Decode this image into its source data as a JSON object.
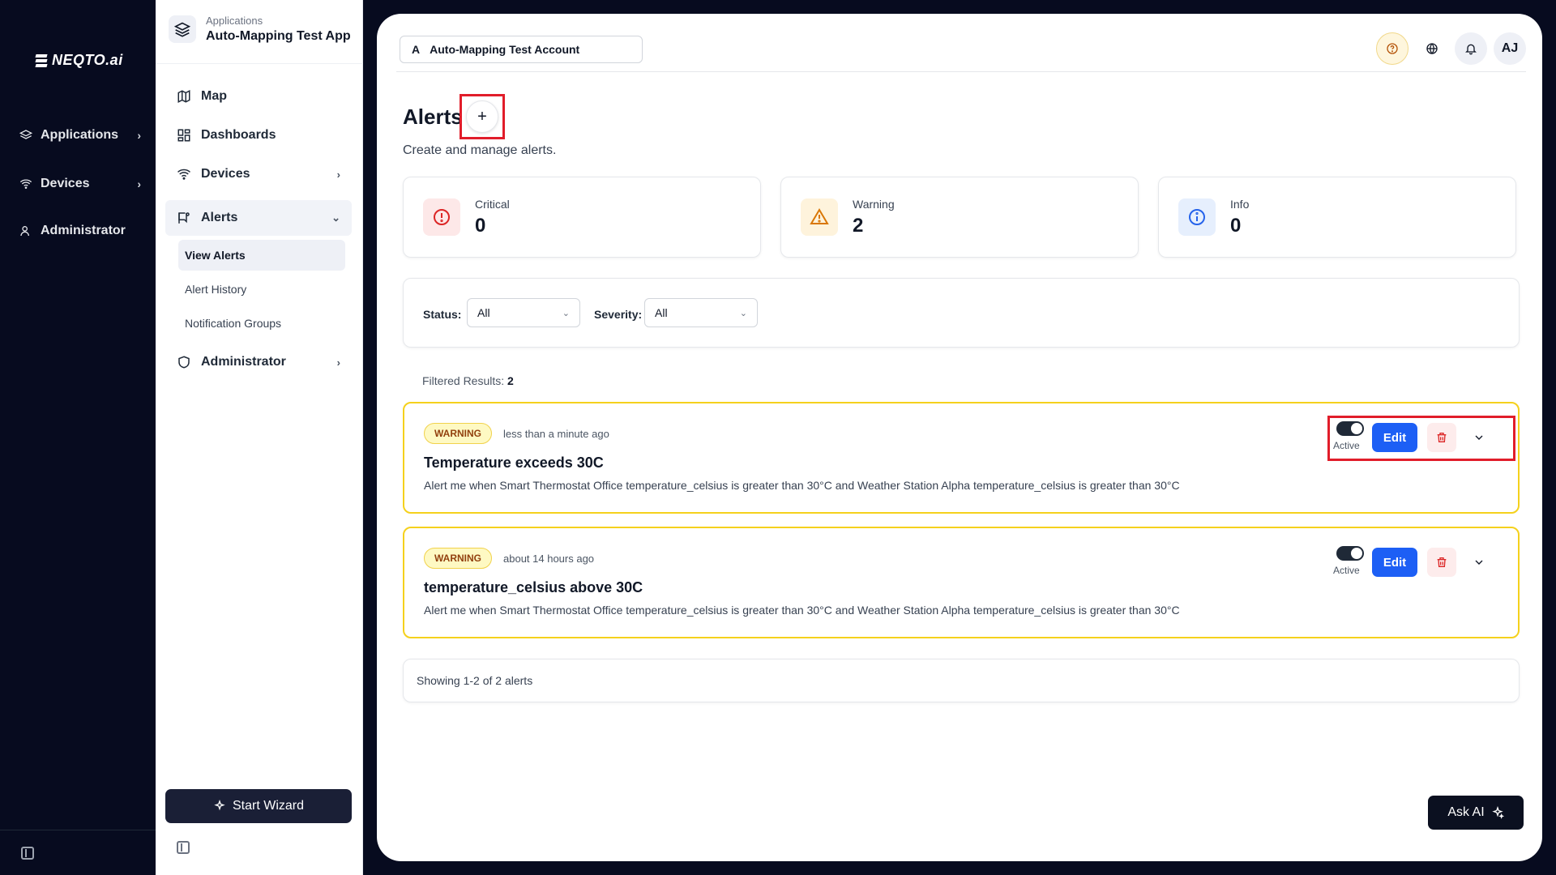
{
  "brand": {
    "name": "NEQTO.ai"
  },
  "rail": {
    "items": [
      {
        "label": "Applications",
        "icon": "layers-icon"
      },
      {
        "label": "Devices",
        "icon": "wifi-icon"
      },
      {
        "label": "Administrator",
        "icon": "user-icon"
      }
    ]
  },
  "app": {
    "kicker": "Applications",
    "name": "Auto-Mapping Test App"
  },
  "sidebar": {
    "nav": [
      {
        "label": "Map",
        "icon": "map-icon"
      },
      {
        "label": "Dashboards",
        "icon": "dashboard-icon"
      },
      {
        "label": "Devices",
        "icon": "wifi-icon"
      },
      {
        "label": "Alerts",
        "icon": "alert-flag-icon"
      },
      {
        "label": "Administrator",
        "icon": "shield-icon"
      }
    ],
    "alerts_sub": [
      {
        "label": "View Alerts"
      },
      {
        "label": "Alert History"
      },
      {
        "label": "Notification Groups"
      }
    ],
    "wizard_label": "Start Wizard"
  },
  "header": {
    "account_initial": "A",
    "account_name": "Auto-Mapping Test Account",
    "avatar_initials": "AJ"
  },
  "page": {
    "title": "Alerts",
    "add_symbol": "+",
    "subtitle": "Create and manage alerts."
  },
  "stats": [
    {
      "label": "Critical",
      "value": "0",
      "color": "#dc2626"
    },
    {
      "label": "Warning",
      "value": "2",
      "color": "#d97706"
    },
    {
      "label": "Info",
      "value": "0",
      "color": "#2563eb"
    }
  ],
  "filters": {
    "status_label": "Status:",
    "status_value": "All",
    "severity_label": "Severity:",
    "severity_value": "All"
  },
  "results": {
    "label": "Filtered Results:",
    "count": "2"
  },
  "alerts": [
    {
      "severity": "WARNING",
      "time": "less than a minute ago",
      "title": "Temperature exceeds 30C",
      "description": "Alert me when Smart Thermostat Office temperature_celsius is greater than 30°C and Weather Station Alpha temperature_celsius is greater than 30°C",
      "toggle_label": "Active",
      "active": true,
      "edit_label": "Edit"
    },
    {
      "severity": "WARNING",
      "time": "about 14 hours ago",
      "title": "temperature_celsius above 30C",
      "description": "Alert me when Smart Thermostat Office temperature_celsius is greater than 30°C and Weather Station Alpha temperature_celsius is greater than 30°C",
      "toggle_label": "Active",
      "active": true,
      "edit_label": "Edit"
    }
  ],
  "pagination": {
    "text": "Showing 1-2 of 2 alerts"
  },
  "ask_ai": {
    "label": "Ask AI"
  },
  "colors": {
    "highlight": "#e11d2a",
    "accent": "#1d5ff5",
    "warning_border": "#f5d11c",
    "dark": "#070b1f"
  }
}
